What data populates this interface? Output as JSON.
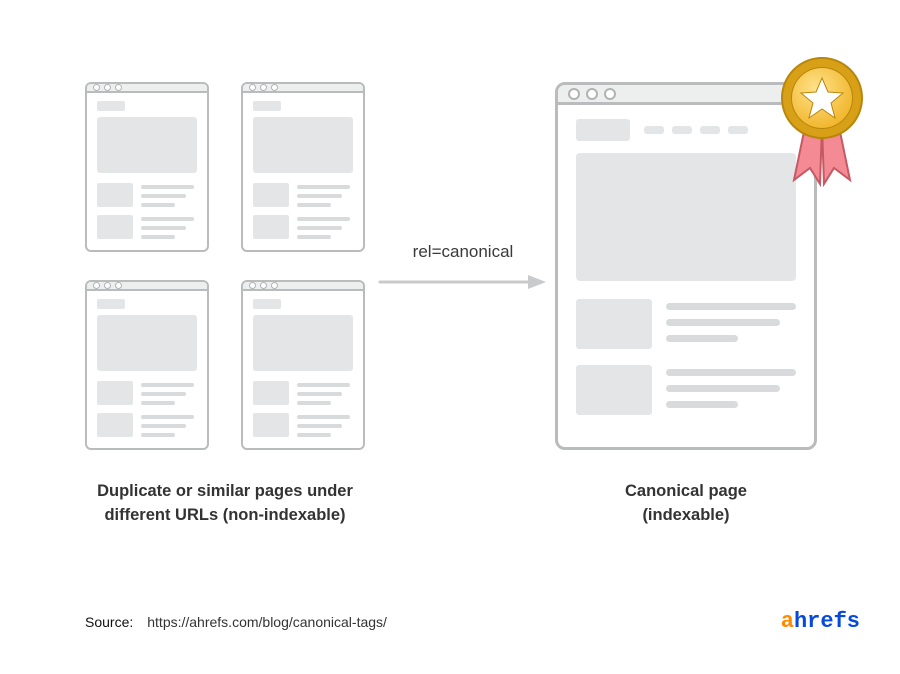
{
  "arrow_label": "rel=canonical",
  "captions": {
    "left_line1": "Duplicate or similar pages under",
    "left_line2": "different URLs (non-indexable)",
    "right_line1": "Canonical page",
    "right_line2": "(indexable)"
  },
  "footer": {
    "source_label": "Source:",
    "source_url": "https://ahrefs.com/blog/canonical-tags/",
    "brand_prefix": "a",
    "brand_suffix": "hrefs"
  },
  "colors": {
    "outline": "#b9bbbd",
    "fill": "#e4e5e6",
    "arrow": "#c9cacb",
    "brand_blue": "#054ada",
    "brand_orange": "#ff8a00",
    "gold_outer": "#d8a016",
    "gold_inner": "#f7c948",
    "ribbon": "#f48a94"
  }
}
